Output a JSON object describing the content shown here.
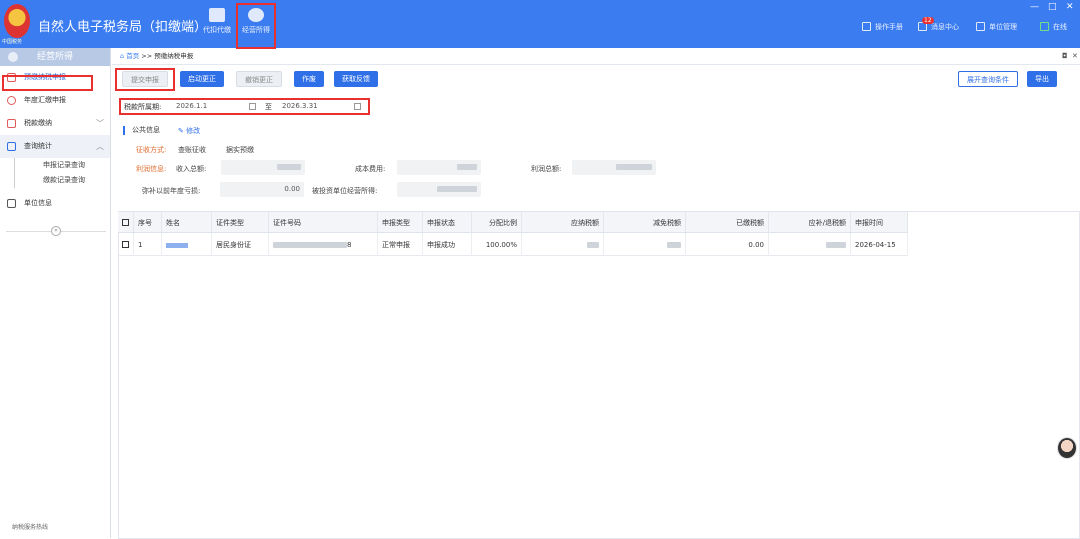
{
  "header": {
    "app_title": "自然人电子税务局（扣缴端）",
    "logo_text": "中国税务",
    "nav": [
      {
        "label": "代扣代缴"
      },
      {
        "label": "经营所得"
      }
    ],
    "right_items": [
      {
        "label": "操作手册"
      },
      {
        "label": "消息中心"
      },
      {
        "label": "单位管理"
      },
      {
        "label": "在线"
      }
    ],
    "message_badge": "12",
    "window_controls": [
      "—",
      "□",
      "✕"
    ]
  },
  "sidebar": {
    "title": "经营所得",
    "items": [
      {
        "label": "预缴纳税申报"
      },
      {
        "label": "年度汇缴申报"
      },
      {
        "label": "税款缴纳",
        "chevron": "﹀"
      },
      {
        "label": "查询统计",
        "chevron": "︿"
      },
      {
        "label": "单位信息"
      }
    ],
    "sub_items": [
      {
        "label": "申报记录查询"
      },
      {
        "label": "缴款记录查询"
      }
    ],
    "collapse_symbol": "«",
    "footer": "纳税服务热线"
  },
  "breadcrumb": {
    "home": "首页",
    "separator": ">>",
    "current": "预缴纳税申报",
    "controls": [
      "◘",
      "✕"
    ]
  },
  "toolbar": {
    "submit": "提交申报",
    "start_correction": "启动更正",
    "cancel_correction": "撤销更正",
    "void": "作废",
    "get_feedback": "获取反馈",
    "expand_query": "展开查询条件",
    "export": "导出"
  },
  "period": {
    "label": "税款所属期:",
    "from": "2026.1.1",
    "to_label": "至",
    "to": "2026.3.31"
  },
  "public_info": {
    "title": "公共信息",
    "edit": "修改",
    "collection_label": "征收方式:",
    "collection_opt1": "查账征收",
    "collection_opt2": "据实预缴",
    "profit_label": "利润信息:",
    "income_label": "收入总额:",
    "cost_label": "成本费用:",
    "profit_total_label": "利润总额:",
    "loss_label": "弥补以前年度亏损:",
    "loss_value": "0.00",
    "investee_label": "被投资单位经营所得:"
  },
  "table": {
    "columns": [
      "序号",
      "姓名",
      "证件类型",
      "证件号码",
      "申报类型",
      "申报状态",
      "分配比例",
      "应纳税额",
      "减免税额",
      "已缴税额",
      "应补/退税额",
      "申报时间"
    ],
    "rows": [
      {
        "index": "1",
        "id_type": "居民身份证",
        "id_suffix": "8",
        "declare_type": "正常申报",
        "status": "申报成功",
        "ratio": "100.00%",
        "paid_tax": "0.00",
        "date": "2026-04-15"
      }
    ]
  },
  "colors": {
    "topbar": "#3b7cf0",
    "accent": "#2f6fe8",
    "highlight": "#e8312f",
    "profit_label": "#e06b2c"
  }
}
